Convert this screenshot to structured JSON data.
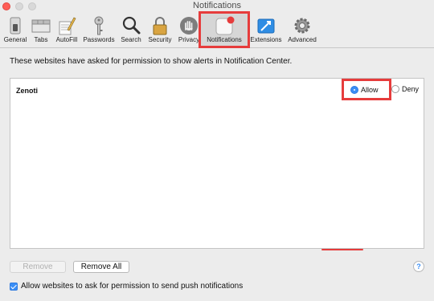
{
  "window": {
    "title": "Notifications"
  },
  "toolbar": {
    "items": [
      {
        "label": "General",
        "icon": "general-switch-icon"
      },
      {
        "label": "Tabs",
        "icon": "tabs-icon"
      },
      {
        "label": "AutoFill",
        "icon": "pencil-icon"
      },
      {
        "label": "Passwords",
        "icon": "key-icon"
      },
      {
        "label": "Search",
        "icon": "magnifier-icon"
      },
      {
        "label": "Security",
        "icon": "padlock-icon"
      },
      {
        "label": "Privacy",
        "icon": "hand-icon"
      },
      {
        "label": "Notifications",
        "icon": "notifications-icon",
        "active": true
      },
      {
        "label": "Extensions",
        "icon": "puzzle-icon"
      },
      {
        "label": "Advanced",
        "icon": "gear-icon"
      }
    ]
  },
  "main": {
    "description": "These websites have asked for permission to show alerts in Notification Center.",
    "websites": [
      {
        "name": "Zenoti",
        "permission": "Allow"
      }
    ],
    "allow_label": "Allow",
    "deny_label": "Deny"
  },
  "footer": {
    "remove_label": "Remove",
    "remove_all_label": "Remove All",
    "help_label": "?",
    "checkbox_label": "Allow websites to ask for permission to send push notifications",
    "checkbox_checked": true
  },
  "colors": {
    "accent": "#3a8ef6",
    "highlight": "#e63c3c",
    "background": "#ececec"
  }
}
